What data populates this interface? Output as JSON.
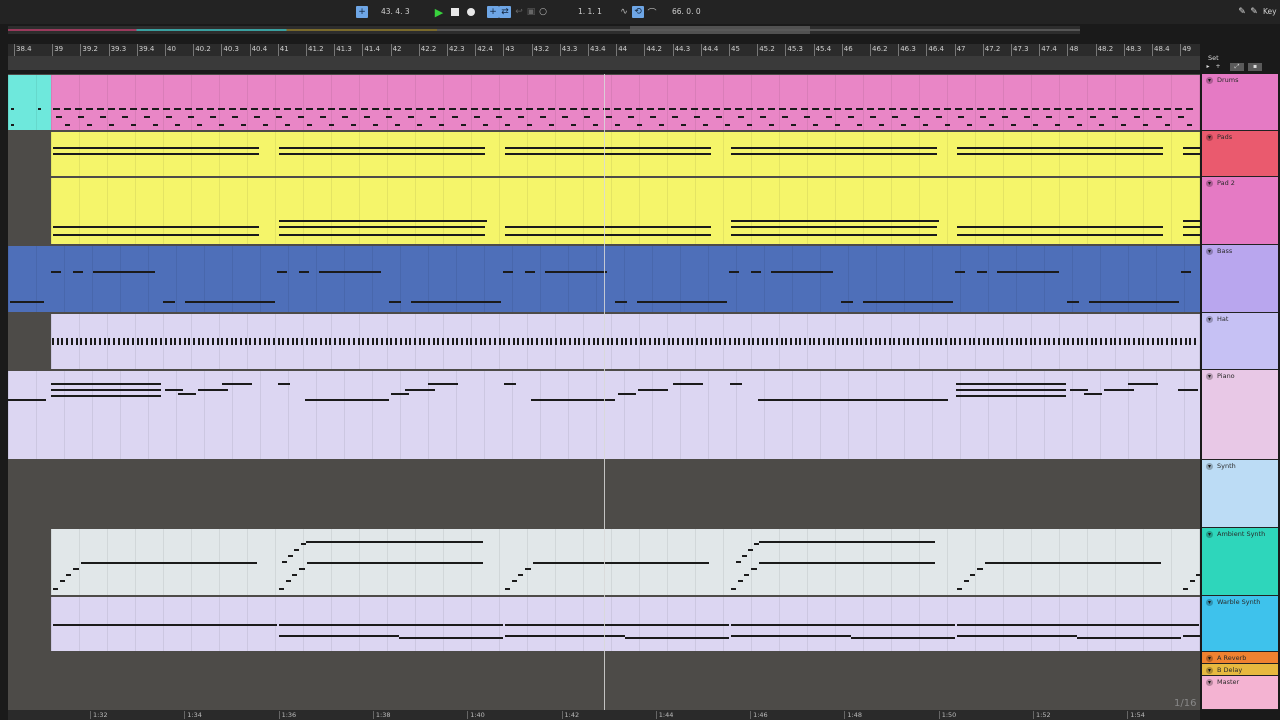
{
  "transport": {
    "position": "43. 4. 3",
    "loop_start": "1. 1. 1",
    "loop_length": "66. 0. 0",
    "key_label": "Key"
  },
  "ruler_labels": [
    "38.4",
    "39",
    "39.2",
    "39.3",
    "39.4",
    "40",
    "40.2",
    "40.3",
    "40.4",
    "41",
    "41.2",
    "41.3",
    "41.4",
    "42",
    "42.2",
    "42.3",
    "42.4",
    "43",
    "43.2",
    "43.3",
    "43.4",
    "44",
    "44.2",
    "44.3",
    "44.4",
    "45",
    "45.2",
    "45.3",
    "45.4",
    "46",
    "46.2",
    "46.3",
    "46.4",
    "47",
    "47.2",
    "47.3",
    "47.4",
    "48",
    "48.2",
    "48.3",
    "48.4",
    "49"
  ],
  "time_labels": [
    "1:32",
    "1:34",
    "1:36",
    "1:38",
    "1:40",
    "1:42",
    "1:44",
    "1:46",
    "1:48",
    "1:50",
    "1:52",
    "1:54"
  ],
  "set_label": "Set",
  "tracks": [
    {
      "name": "Drums",
      "color": "#e57ac4"
    },
    {
      "name": "Pads",
      "color": "#ea5a6e"
    },
    {
      "name": "Pad 2",
      "color": "#e57ac4"
    },
    {
      "name": "Bass",
      "color": "#b9a6ee"
    },
    {
      "name": "Hat",
      "color": "#c6c1f4"
    },
    {
      "name": "Piano",
      "color": "#e8c8e6"
    },
    {
      "name": "Synth",
      "color": "#bcdcf5"
    },
    {
      "name": "Ambient Synth",
      "color": "#2ed6bb"
    },
    {
      "name": "Warble Synth",
      "color": "#3ec2ec"
    },
    {
      "name": "A Reverb",
      "color": "#f08230"
    },
    {
      "name": "B Delay",
      "color": "#e7b93f"
    },
    {
      "name": "Master",
      "color": "#f4b3d2"
    }
  ],
  "clip_colors": {
    "drums": "#e986c6",
    "drums_cue": "#6ee8dc",
    "pads": "#f5f56a",
    "bass": "#4e6fb9",
    "hat": "#dcd6f2",
    "piano": "#dcd6f2",
    "ambient": "#e1e7e9",
    "warble": "#dcd6f2"
  },
  "page_counter": "1/16"
}
